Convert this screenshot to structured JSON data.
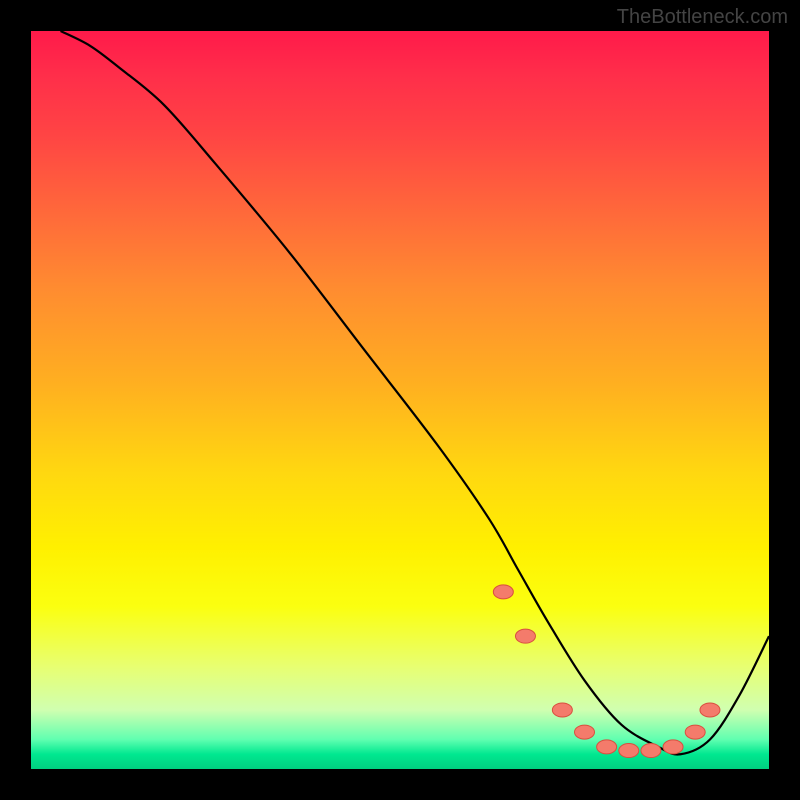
{
  "watermark": "TheBottleneck.com",
  "chart_data": {
    "type": "line",
    "title": "",
    "xlabel": "",
    "ylabel": "",
    "xlim": [
      0,
      100
    ],
    "ylim": [
      0,
      100
    ],
    "series": [
      {
        "name": "curve",
        "x": [
          4,
          8,
          12,
          18,
          25,
          35,
          45,
          55,
          62,
          66,
          70,
          75,
          80,
          85,
          88,
          92,
          96,
          100
        ],
        "y": [
          100,
          98,
          95,
          90,
          82,
          70,
          57,
          44,
          34,
          27,
          20,
          12,
          6,
          3,
          2,
          4,
          10,
          18
        ]
      }
    ],
    "markers": [
      {
        "x": 64,
        "y": 24
      },
      {
        "x": 67,
        "y": 18
      },
      {
        "x": 72,
        "y": 8
      },
      {
        "x": 75,
        "y": 5
      },
      {
        "x": 78,
        "y": 3
      },
      {
        "x": 81,
        "y": 2.5
      },
      {
        "x": 84,
        "y": 2.5
      },
      {
        "x": 87,
        "y": 3
      },
      {
        "x": 90,
        "y": 5
      },
      {
        "x": 92,
        "y": 8
      }
    ],
    "colors": {
      "background_top": "#ff1a4a",
      "background_bottom": "#00d080",
      "curve": "#000000",
      "marker_fill": "#f47b6b",
      "marker_stroke": "#d94f3f"
    }
  }
}
